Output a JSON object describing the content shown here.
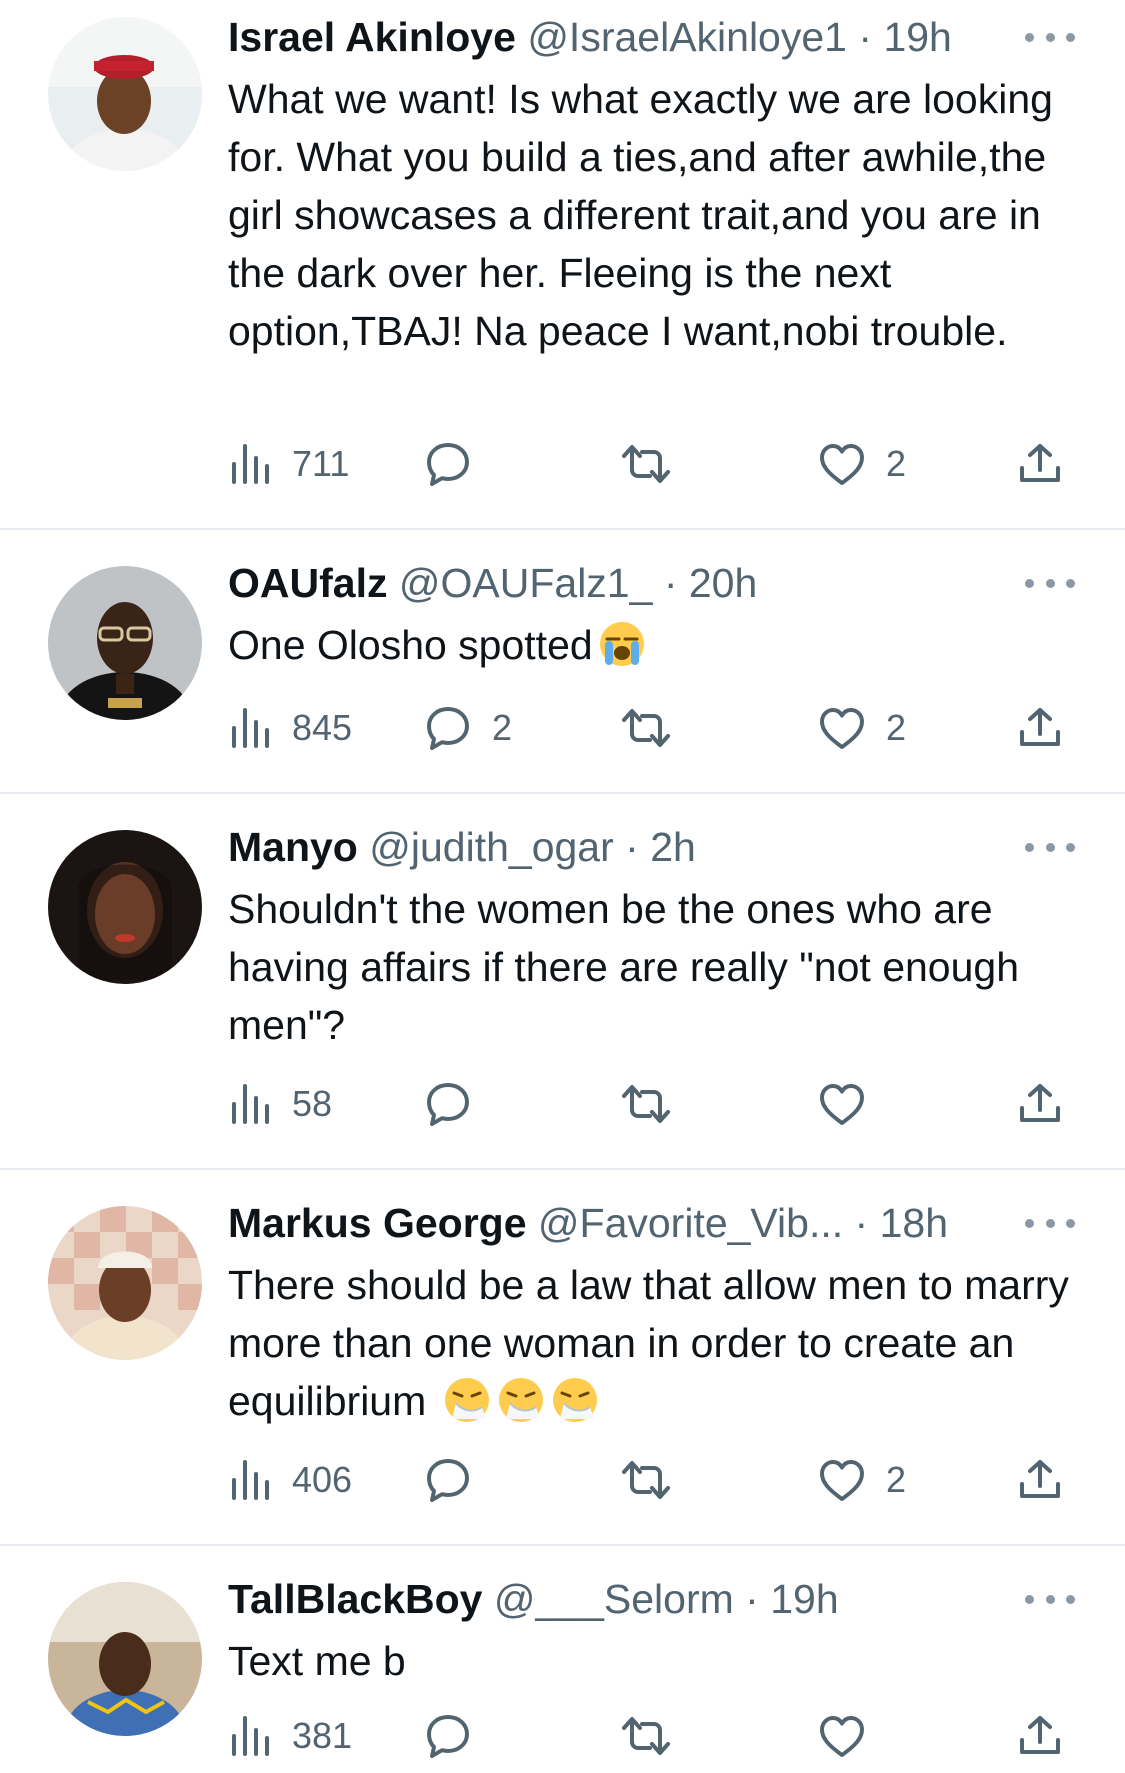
{
  "tweets": [
    {
      "name": "Israel Akinloye",
      "handle": "@IsraelAkinloye1",
      "time": "19h",
      "text": "What we want! Is what exactly we are looking for. What you build a ties,and after awhile,the girl showcases a different trait,and you are in the dark over her. Fleeing is the next option,TBAJ! Na peace I want,nobi trouble.",
      "views": "711",
      "replies": "",
      "retweets": "",
      "likes": "2"
    },
    {
      "name": "OAUfalz",
      "handle": "@OAUFalz1_",
      "time": "20h",
      "text": "One Olosho spotted",
      "views": "845",
      "replies": "2",
      "retweets": "",
      "likes": "2"
    },
    {
      "name": "Manyo",
      "handle": "@judith_ogar",
      "time": "2h",
      "text": "Shouldn't the women be the ones who are having affairs if there are really \"not enough men\"?",
      "views": "58",
      "replies": "",
      "retweets": "",
      "likes": ""
    },
    {
      "name": "Markus George",
      "handle": "@Favorite_Vib...",
      "time": "18h",
      "text": "There should be a law that allow men to marry more than one woman in order to create an equilibrium",
      "views": "406",
      "replies": "",
      "retweets": "",
      "likes": "2"
    },
    {
      "name": "TallBlackBoy",
      "handle": "@___Selorm",
      "time": "19h",
      "text": "Text me b",
      "views": "381",
      "replies": "",
      "retweets": "",
      "likes": ""
    }
  ],
  "separator": "·",
  "icons": {
    "views": "bar-chart-icon",
    "reply": "speech-bubble-icon",
    "retweet": "retweet-arrows-icon",
    "like": "heart-outline-icon",
    "share": "share-upload-icon",
    "more": "ellipsis-icon",
    "emoji_crying": "loudly-crying-face-emoji",
    "emoji_sneezing": "sneezing-face-emoji"
  },
  "colors": {
    "text": "#0f1419",
    "secondary": "#536471",
    "divider": "#e6ecf0",
    "background": "#ffffff"
  }
}
